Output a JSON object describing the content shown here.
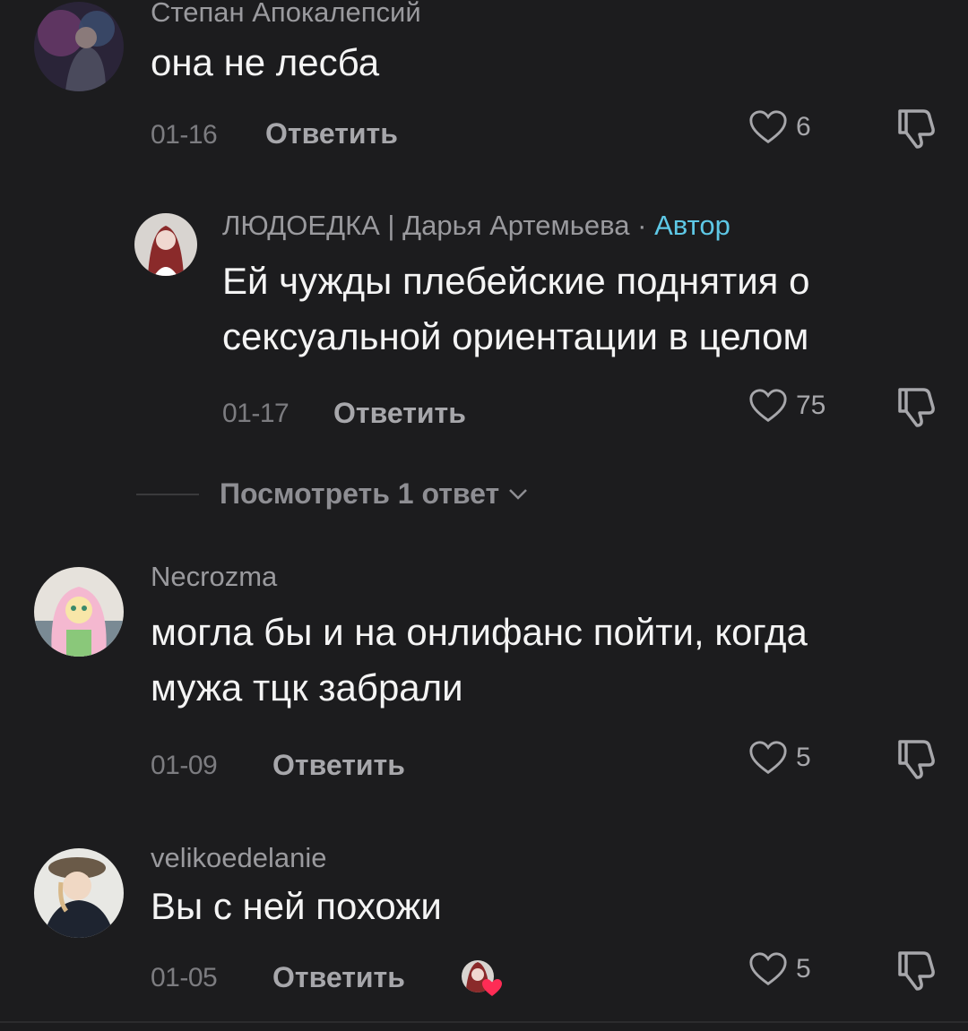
{
  "comments": [
    {
      "username": "Степан Апокалепсий",
      "text": "она не лесба",
      "date": "01-16",
      "reply_label": "Ответить",
      "likes": "6"
    },
    {
      "username": "ЛЮДОЕДКА | Дарья Артемьева",
      "author_separator": "·",
      "author_badge": "Автор",
      "text_line1": "Ей чужды плебейские поднятия о",
      "text_line2": "сексуальной ориентации в целом",
      "date": "01-17",
      "reply_label": "Ответить",
      "likes": "75"
    },
    {
      "username": "Necrozma",
      "text_line1": "могла бы и на онлифанс пойти, когда",
      "text_line2": "мужа тцк забрали",
      "date": "01-09",
      "reply_label": "Ответить",
      "likes": "5"
    },
    {
      "username": "velikoedelanie",
      "text": "Вы с ней похожи",
      "date": "01-05",
      "reply_label": "Ответить",
      "likes": "5"
    }
  ],
  "view_replies_label": "Посмотреть 1 ответ",
  "icons": {
    "like": "heart-outline-icon",
    "dislike": "thumbs-down-icon",
    "expand": "chevron-down-icon",
    "creator_liked": "creator-liked-heart-icon"
  },
  "colors": {
    "background": "#1c1c1e",
    "author_badge": "#5ec8e6",
    "creator_heart": "#fe2c55"
  }
}
